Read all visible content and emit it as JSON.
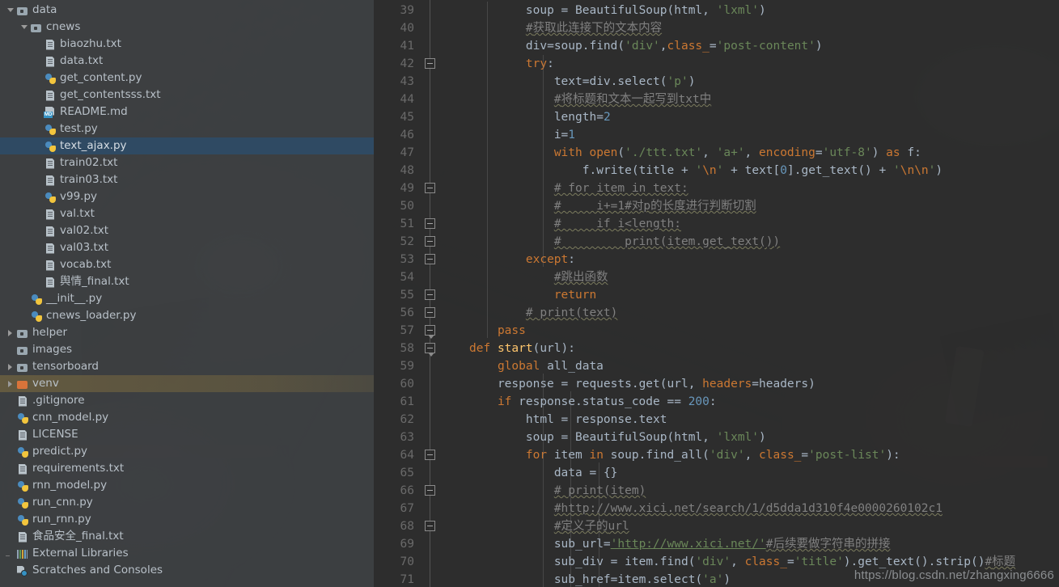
{
  "sidebar": {
    "name": "project-tree",
    "items": [
      {
        "label": "data",
        "indent": 0,
        "icon": "folder-icon",
        "arrow": "open",
        "state": "normal"
      },
      {
        "label": "cnews",
        "indent": 1,
        "icon": "folder-icon",
        "arrow": "open",
        "state": "normal"
      },
      {
        "label": "biaozhu.txt",
        "indent": 2,
        "icon": "text-file-icon",
        "arrow": "none",
        "state": "normal"
      },
      {
        "label": "data.txt",
        "indent": 2,
        "icon": "text-file-icon",
        "arrow": "none",
        "state": "normal"
      },
      {
        "label": "get_content.py",
        "indent": 2,
        "icon": "python-file-icon",
        "arrow": "none",
        "state": "normal"
      },
      {
        "label": "get_contentsss.txt",
        "indent": 2,
        "icon": "text-file-icon",
        "arrow": "none",
        "state": "normal"
      },
      {
        "label": "README.md",
        "indent": 2,
        "icon": "markdown-file-icon",
        "arrow": "none",
        "state": "normal"
      },
      {
        "label": "test.py",
        "indent": 2,
        "icon": "python-file-icon",
        "arrow": "none",
        "state": "normal"
      },
      {
        "label": "text_ajax.py",
        "indent": 2,
        "icon": "python-file-icon",
        "arrow": "none",
        "state": "selected"
      },
      {
        "label": "train02.txt",
        "indent": 2,
        "icon": "text-file-icon",
        "arrow": "none",
        "state": "normal"
      },
      {
        "label": "train03.txt",
        "indent": 2,
        "icon": "text-file-icon",
        "arrow": "none",
        "state": "normal"
      },
      {
        "label": "v99.py",
        "indent": 2,
        "icon": "python-file-icon",
        "arrow": "none",
        "state": "normal"
      },
      {
        "label": "val.txt",
        "indent": 2,
        "icon": "text-file-icon",
        "arrow": "none",
        "state": "normal"
      },
      {
        "label": "val02.txt",
        "indent": 2,
        "icon": "text-file-icon",
        "arrow": "none",
        "state": "normal"
      },
      {
        "label": "val03.txt",
        "indent": 2,
        "icon": "text-file-icon",
        "arrow": "none",
        "state": "normal"
      },
      {
        "label": "vocab.txt",
        "indent": 2,
        "icon": "text-file-icon",
        "arrow": "none",
        "state": "normal"
      },
      {
        "label": "舆情_final.txt",
        "indent": 2,
        "icon": "text-file-icon",
        "arrow": "none",
        "state": "normal"
      },
      {
        "label": "__init__.py",
        "indent": 1,
        "icon": "python-file-icon",
        "arrow": "none",
        "state": "normal"
      },
      {
        "label": "cnews_loader.py",
        "indent": 1,
        "icon": "python-file-icon",
        "arrow": "none",
        "state": "normal"
      },
      {
        "label": "helper",
        "indent": 0,
        "icon": "folder-icon",
        "arrow": "closed",
        "state": "normal"
      },
      {
        "label": "images",
        "indent": 0,
        "icon": "folder-icon",
        "arrow": "none",
        "state": "normal"
      },
      {
        "label": "tensorboard",
        "indent": 0,
        "icon": "folder-icon",
        "arrow": "closed",
        "state": "normal"
      },
      {
        "label": "venv",
        "indent": 0,
        "icon": "folder-orange-icon",
        "arrow": "closed",
        "state": "highlighted"
      },
      {
        "label": ".gitignore",
        "indent": 0,
        "icon": "text-file-icon",
        "arrow": "none",
        "state": "normal"
      },
      {
        "label": "cnn_model.py",
        "indent": 0,
        "icon": "python-file-icon",
        "arrow": "none",
        "state": "normal"
      },
      {
        "label": "LICENSE",
        "indent": 0,
        "icon": "text-file-icon",
        "arrow": "none",
        "state": "normal"
      },
      {
        "label": "predict.py",
        "indent": 0,
        "icon": "python-file-icon",
        "arrow": "none",
        "state": "normal"
      },
      {
        "label": "requirements.txt",
        "indent": 0,
        "icon": "text-file-icon",
        "arrow": "none",
        "state": "normal"
      },
      {
        "label": "rnn_model.py",
        "indent": 0,
        "icon": "python-file-icon",
        "arrow": "none",
        "state": "normal"
      },
      {
        "label": "run_cnn.py",
        "indent": 0,
        "icon": "python-file-icon",
        "arrow": "none",
        "state": "normal"
      },
      {
        "label": "run_rnn.py",
        "indent": 0,
        "icon": "python-file-icon",
        "arrow": "none",
        "state": "normal"
      },
      {
        "label": "食品安全_final.txt",
        "indent": 0,
        "icon": "text-file-icon",
        "arrow": "none",
        "state": "normal"
      },
      {
        "label": "External Libraries",
        "indent": -1,
        "icon": "external-libraries-icon",
        "arrow": "dash",
        "state": "normal"
      },
      {
        "label": "Scratches and Consoles",
        "indent": -1,
        "icon": "scratches-icon",
        "arrow": "none",
        "state": "normal"
      }
    ]
  },
  "editor": {
    "name": "code-editor",
    "language": "Python",
    "first_line_number": 39,
    "line_numbers": [
      39,
      40,
      41,
      42,
      43,
      44,
      45,
      46,
      47,
      48,
      49,
      50,
      51,
      52,
      53,
      54,
      55,
      56,
      57,
      58,
      59,
      60,
      61,
      62,
      63,
      64,
      65,
      66,
      67,
      68,
      69,
      70,
      71
    ],
    "lines": [
      {
        "n": 39,
        "text": "        soup = BeautifulSoup(html, 'lxml')"
      },
      {
        "n": 40,
        "text": "        #获取此连接下的文本内容"
      },
      {
        "n": 41,
        "text": "        div=soup.find('div',class_='post-content')"
      },
      {
        "n": 42,
        "text": "        try:"
      },
      {
        "n": 43,
        "text": "            text=div.select('p')"
      },
      {
        "n": 44,
        "text": "            #将标题和文本一起写到txt中"
      },
      {
        "n": 45,
        "text": "            length=2"
      },
      {
        "n": 46,
        "text": "            i=1"
      },
      {
        "n": 47,
        "text": "            with open('./ttt.txt', 'a+', encoding='utf-8') as f:"
      },
      {
        "n": 48,
        "text": "                f.write(title + '\\n' + text[0].get_text() + '\\n\\n')"
      },
      {
        "n": 49,
        "text": "            # for item in text:"
      },
      {
        "n": 50,
        "text": "            #     i+=1#对p的长度进行判断切割"
      },
      {
        "n": 51,
        "text": "            #     if i<length:"
      },
      {
        "n": 52,
        "text": "            #         print(item.get_text())"
      },
      {
        "n": 53,
        "text": "        except:"
      },
      {
        "n": 54,
        "text": "            #跳出函数"
      },
      {
        "n": 55,
        "text": "            return"
      },
      {
        "n": 56,
        "text": "        # print(text)"
      },
      {
        "n": 57,
        "text": "    pass"
      },
      {
        "n": 58,
        "text": "def start(url):"
      },
      {
        "n": 59,
        "text": "    global all_data"
      },
      {
        "n": 60,
        "text": "    response = requests.get(url, headers=headers)"
      },
      {
        "n": 61,
        "text": "    if response.status_code == 200:"
      },
      {
        "n": 62,
        "text": "        html = response.text"
      },
      {
        "n": 63,
        "text": "        soup = BeautifulSoup(html, 'lxml')"
      },
      {
        "n": 64,
        "text": "        for item in soup.find_all('div', class_='post-list'):"
      },
      {
        "n": 65,
        "text": "            data = {}"
      },
      {
        "n": 66,
        "text": "            # print(item)"
      },
      {
        "n": 67,
        "text": "            #http://www.xici.net/search/1/d5dda1d310f4e0000260102c1"
      },
      {
        "n": 68,
        "text": "            #定义子的url"
      },
      {
        "n": 69,
        "text": "            sub_url='http://www.xici.net/'#后续要做字符串的拼接"
      },
      {
        "n": 70,
        "text": "            sub_div = item.find('div', class_='title').get_text().strip()#标题"
      },
      {
        "n": 71,
        "text": "            sub_href=item.select('a')"
      }
    ]
  },
  "watermark": {
    "text": "https://blog.csdn.net/zhangxing6666"
  },
  "theme": {
    "editor_background": "#2b2b2b",
    "sidebar_background": "#3c3f41",
    "selection_background": "#2f4a63",
    "highlight_background": "#7b6a40",
    "keyword_color": "#cc7832",
    "string_color": "#6a8759",
    "number_color": "#6897bb",
    "comment_color": "#808080",
    "function_color": "#ffc66d",
    "default_text_color": "#a9b7c6",
    "line_number_color": "#6a6a6a"
  }
}
